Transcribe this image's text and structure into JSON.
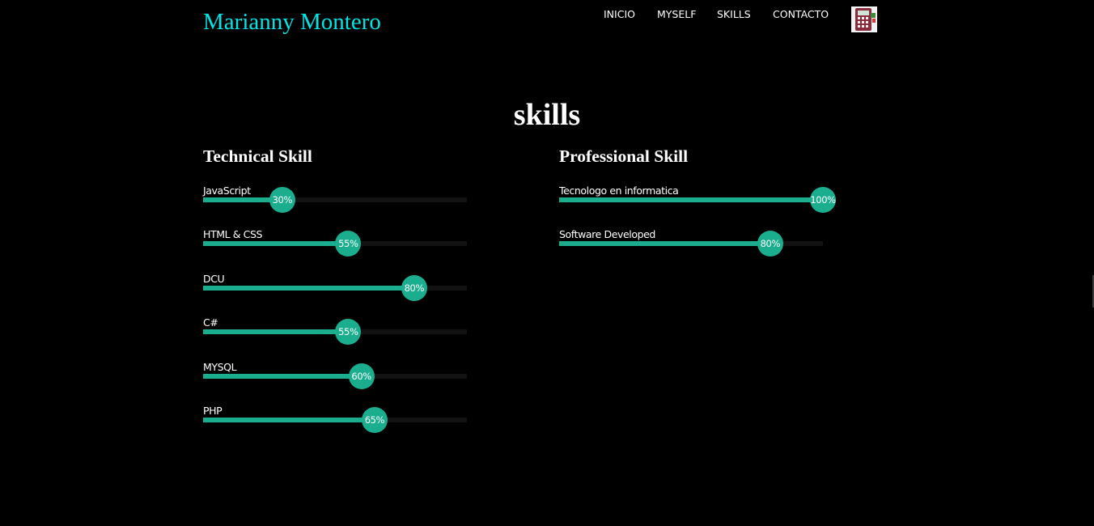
{
  "colors": {
    "brand": "#00e5e5",
    "nav_text": "#ffffff",
    "accent": "#1aae8f",
    "track": "#121212",
    "background": "#000000"
  },
  "header": {
    "brand": "Marianny Montero",
    "nav": [
      {
        "label": "INICIO"
      },
      {
        "label": "MYSELF"
      },
      {
        "label": "SKILLS"
      },
      {
        "label": "CONTACTO"
      }
    ],
    "nav_icon": "calculator-icon"
  },
  "section": {
    "title": "skills"
  },
  "technical": {
    "title": "Technical Skill",
    "skills": [
      {
        "name": "JavaScript",
        "percent": 30,
        "label": "30%"
      },
      {
        "name": "HTML & CSS",
        "percent": 55,
        "label": "55%"
      },
      {
        "name": "DCU",
        "percent": 80,
        "label": "80%"
      },
      {
        "name": "C#",
        "percent": 55,
        "label": "55%"
      },
      {
        "name": "MYSQL",
        "percent": 60,
        "label": "60%"
      },
      {
        "name": "PHP",
        "percent": 65,
        "label": "65%"
      }
    ]
  },
  "professional": {
    "title": "Professional Skill",
    "skills": [
      {
        "name": "Tecnologo en informatica",
        "percent": 100,
        "label": "100%"
      },
      {
        "name": "Software Developed",
        "percent": 80,
        "label": "80%"
      }
    ]
  }
}
